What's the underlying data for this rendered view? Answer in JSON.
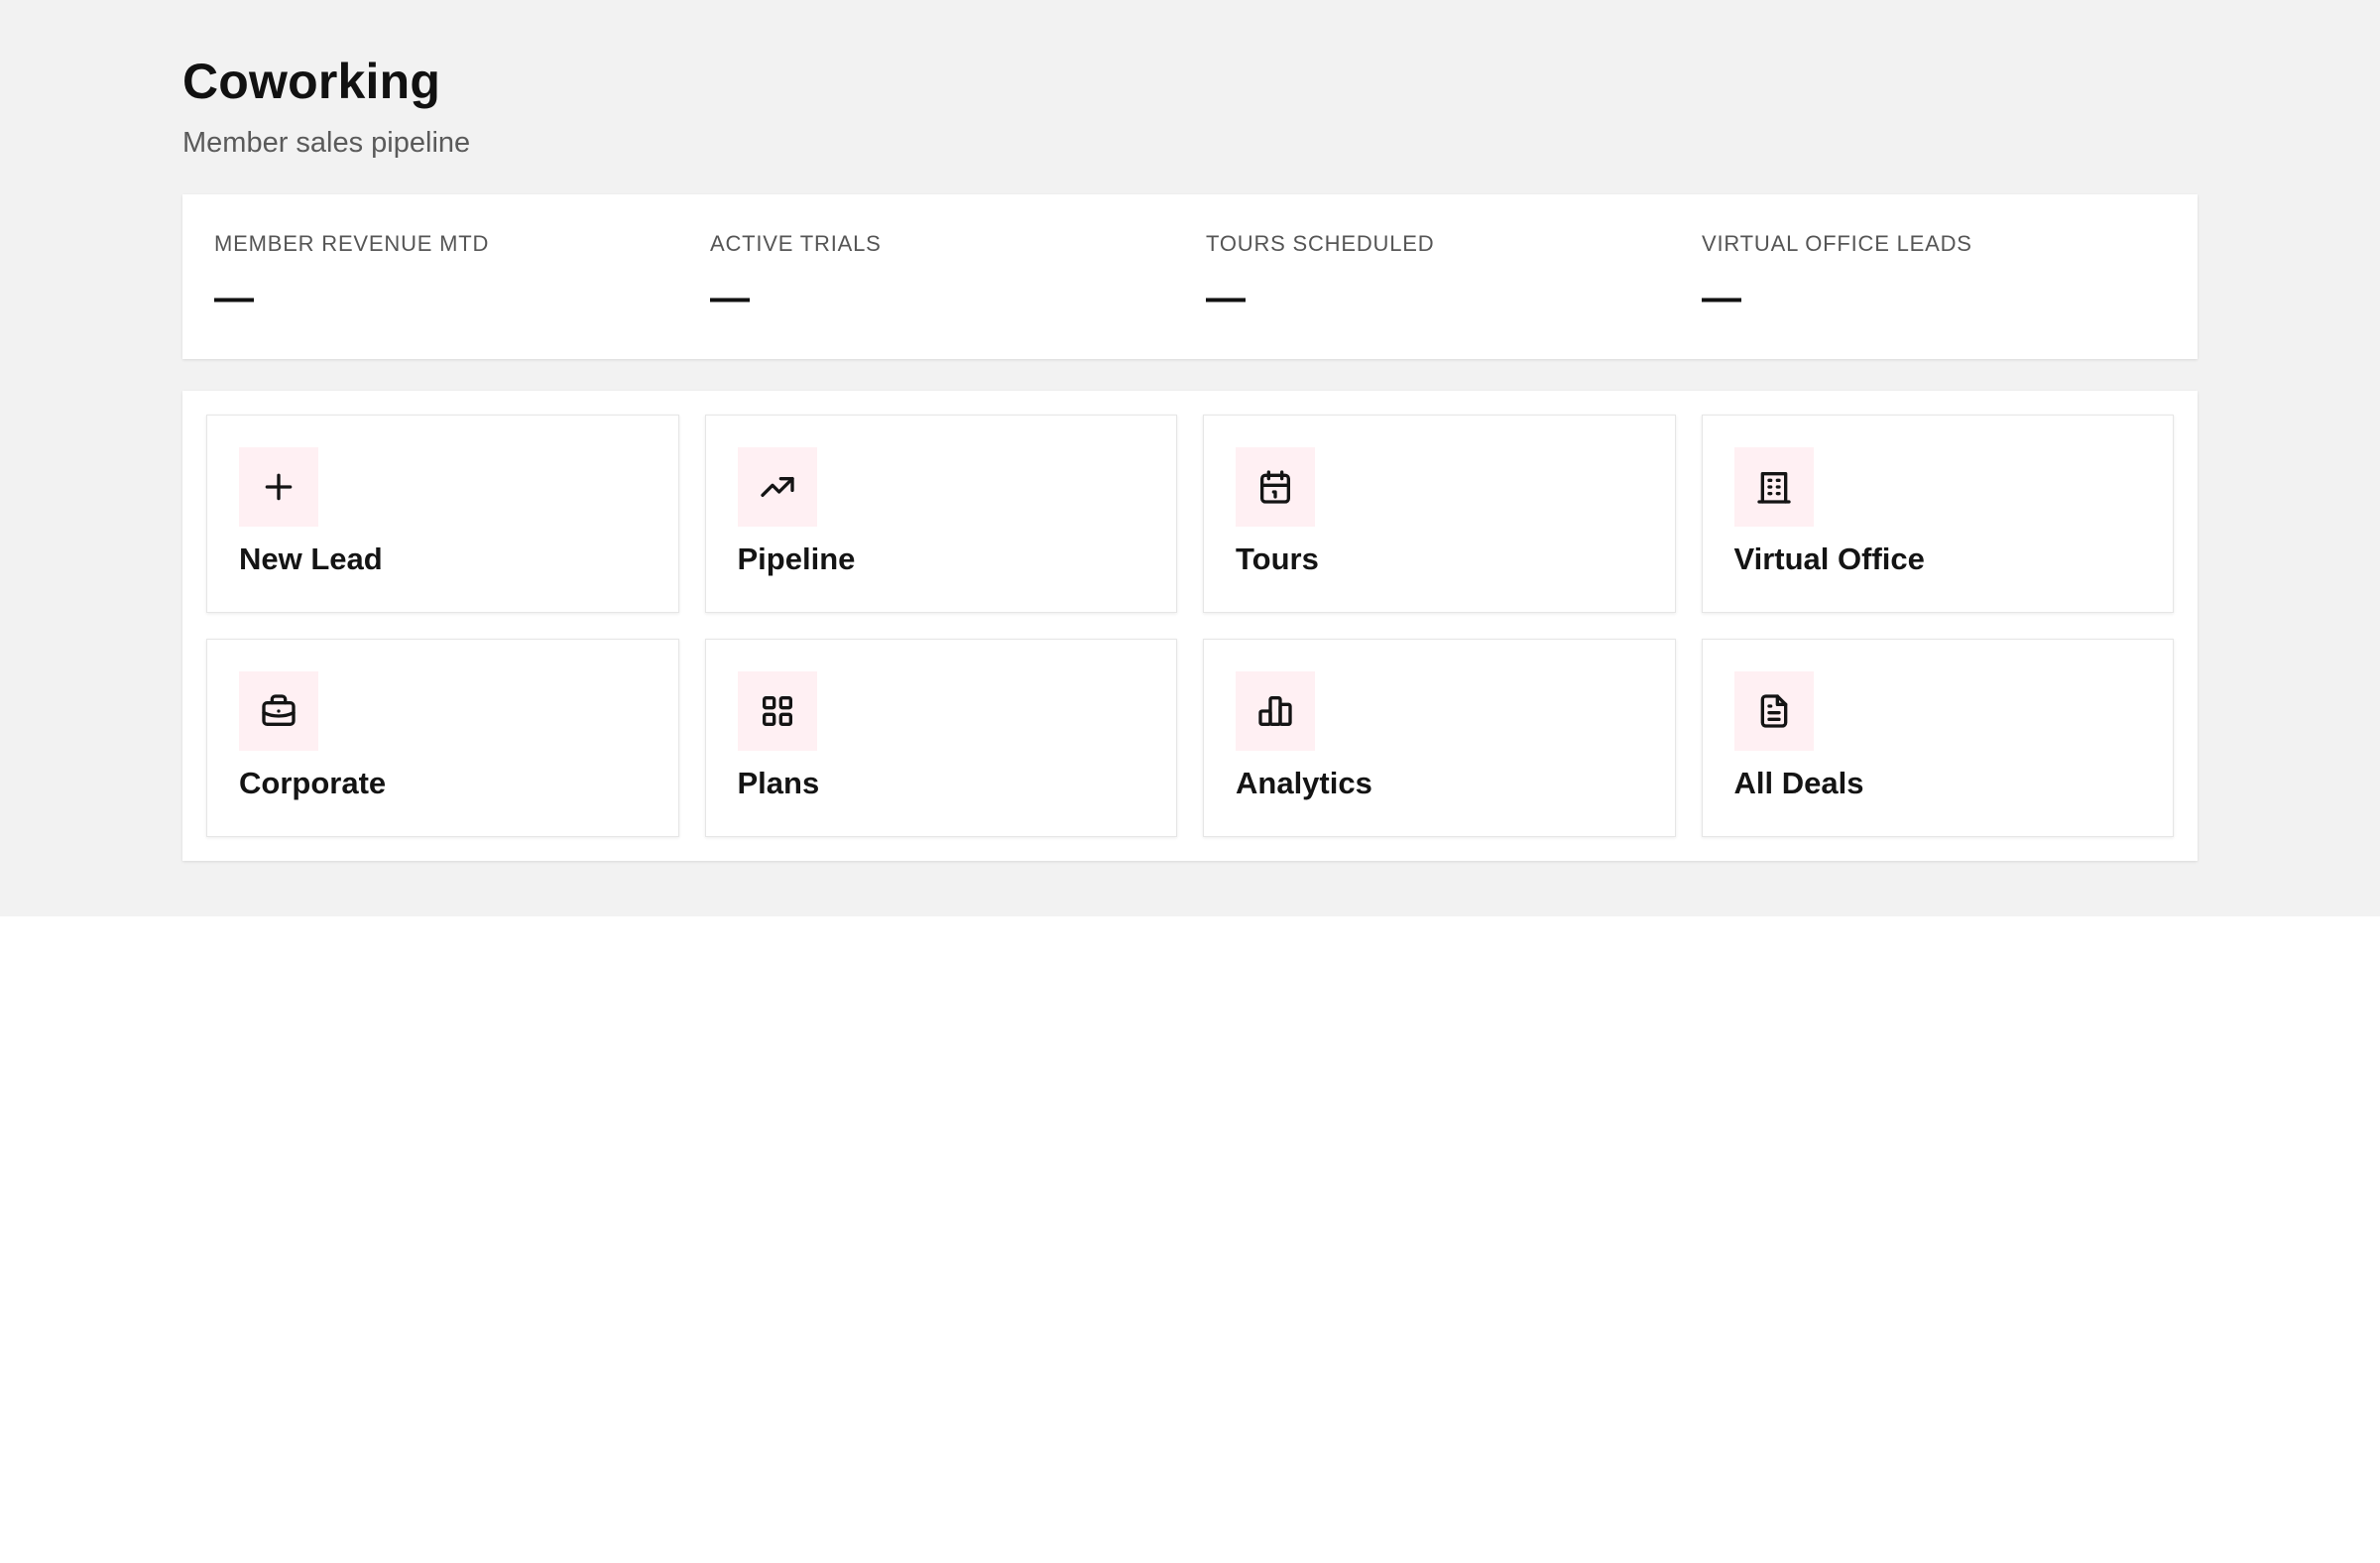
{
  "header": {
    "title": "Coworking",
    "subtitle": "Member sales pipeline"
  },
  "stats": [
    {
      "label": "MEMBER REVENUE MTD",
      "value": "—"
    },
    {
      "label": "ACTIVE TRIALS",
      "value": "—"
    },
    {
      "label": "TOURS SCHEDULED",
      "value": "—"
    },
    {
      "label": "VIRTUAL OFFICE LEADS",
      "value": "—"
    }
  ],
  "actions": [
    {
      "label": "New Lead",
      "icon": "plus-icon"
    },
    {
      "label": "Pipeline",
      "icon": "trending-up-icon"
    },
    {
      "label": "Tours",
      "icon": "calendar-icon"
    },
    {
      "label": "Virtual Office",
      "icon": "building-icon"
    },
    {
      "label": "Corporate",
      "icon": "briefcase-icon"
    },
    {
      "label": "Plans",
      "icon": "grid-icon"
    },
    {
      "label": "Analytics",
      "icon": "bar-chart-icon"
    },
    {
      "label": "All Deals",
      "icon": "file-text-icon"
    }
  ],
  "colors": {
    "page_band": "#f2f2f2",
    "icon_tile_bg": "#fff0f3",
    "text_primary": "#141414",
    "text_secondary": "#555555"
  }
}
